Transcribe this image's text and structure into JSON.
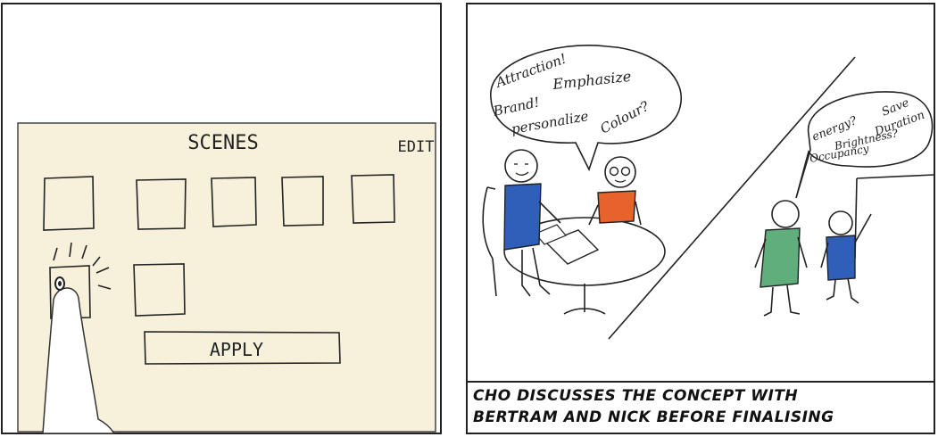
{
  "left_panel": {
    "screen_title": "SCENES",
    "edit_label": "EDIT",
    "apply_label": "APPLY"
  },
  "right_panel": {
    "speech_left": {
      "line1": "Attraction!",
      "line2": "Emphasize",
      "line3": "Brand!",
      "line4": "personalize",
      "line5": "Colour?"
    },
    "speech_right": {
      "line1": "energy?",
      "line2": "Save",
      "line3": "Duration",
      "line4": "Brightness?",
      "line5": "Occupancy"
    },
    "caption_line1": "CHO DISCUSSES THE CONCEPT WITH",
    "caption_line2": "BERTRAM AND NICK BEFORE FINALISING"
  },
  "colors": {
    "screen_fill": "#f7f1dc",
    "blue_shirt": "#2f5fb8",
    "orange_shirt": "#e8622b",
    "green_shirt": "#5fae7c"
  }
}
